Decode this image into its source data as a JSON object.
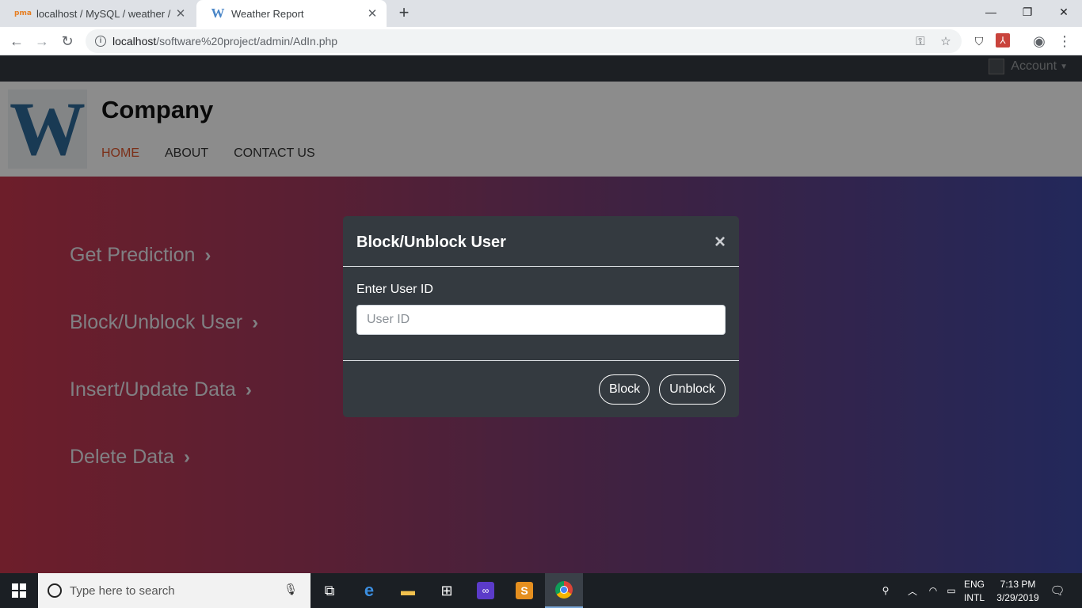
{
  "browser": {
    "tabs": [
      {
        "title": "localhost / MySQL / weather / wc",
        "active": false,
        "favicon": "phpmyadmin-icon"
      },
      {
        "title": "Weather Report",
        "active": true,
        "favicon": "w-logo-icon"
      }
    ],
    "url_host": "localhost",
    "url_path": "/software%20project/admin/AdIn.php"
  },
  "site": {
    "account_label": "Account",
    "company_name": "Company",
    "nav": [
      "HOME",
      "ABOUT",
      "CONTACT US"
    ],
    "nav_active": "HOME",
    "admin_links": [
      "Get Prediction",
      "Block/Unblock User",
      "Insert/Update Data",
      "Delete Data"
    ],
    "logo_letter": "W"
  },
  "modal": {
    "title": "Block/Unblock User",
    "close_glyph": "×",
    "field_label": "Enter User ID",
    "field_placeholder": "User ID",
    "field_value": "",
    "block_label": "Block",
    "unblock_label": "Unblock"
  },
  "taskbar": {
    "search_placeholder": "Type here to search",
    "lang_line1": "ENG",
    "lang_line2": "INTL",
    "time": "7:13 PM",
    "date": "3/29/2019"
  },
  "colors": {
    "accent_nav": "#e0562c",
    "modal_bg": "#343a40",
    "gradient_left": "#c7384e",
    "gradient_right": "#3f49a5"
  }
}
